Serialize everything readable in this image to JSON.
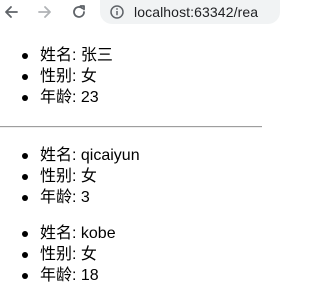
{
  "browser": {
    "url": "localhost:63342/rea",
    "icons": {
      "back": "back-arrow-icon",
      "forward": "forward-arrow-icon",
      "reload": "reload-icon",
      "site_info": "info-icon"
    }
  },
  "people": [
    {
      "name_label": "姓名: 张三",
      "gender_label": "性别: 女",
      "age_label": "年龄: 23"
    },
    {
      "name_label": "姓名: qicaiyun",
      "gender_label": "性别: 女",
      "age_label": "年龄: 3"
    },
    {
      "name_label": "姓名: kobe",
      "gender_label": "性别: 女",
      "age_label": "年龄: 18"
    }
  ]
}
